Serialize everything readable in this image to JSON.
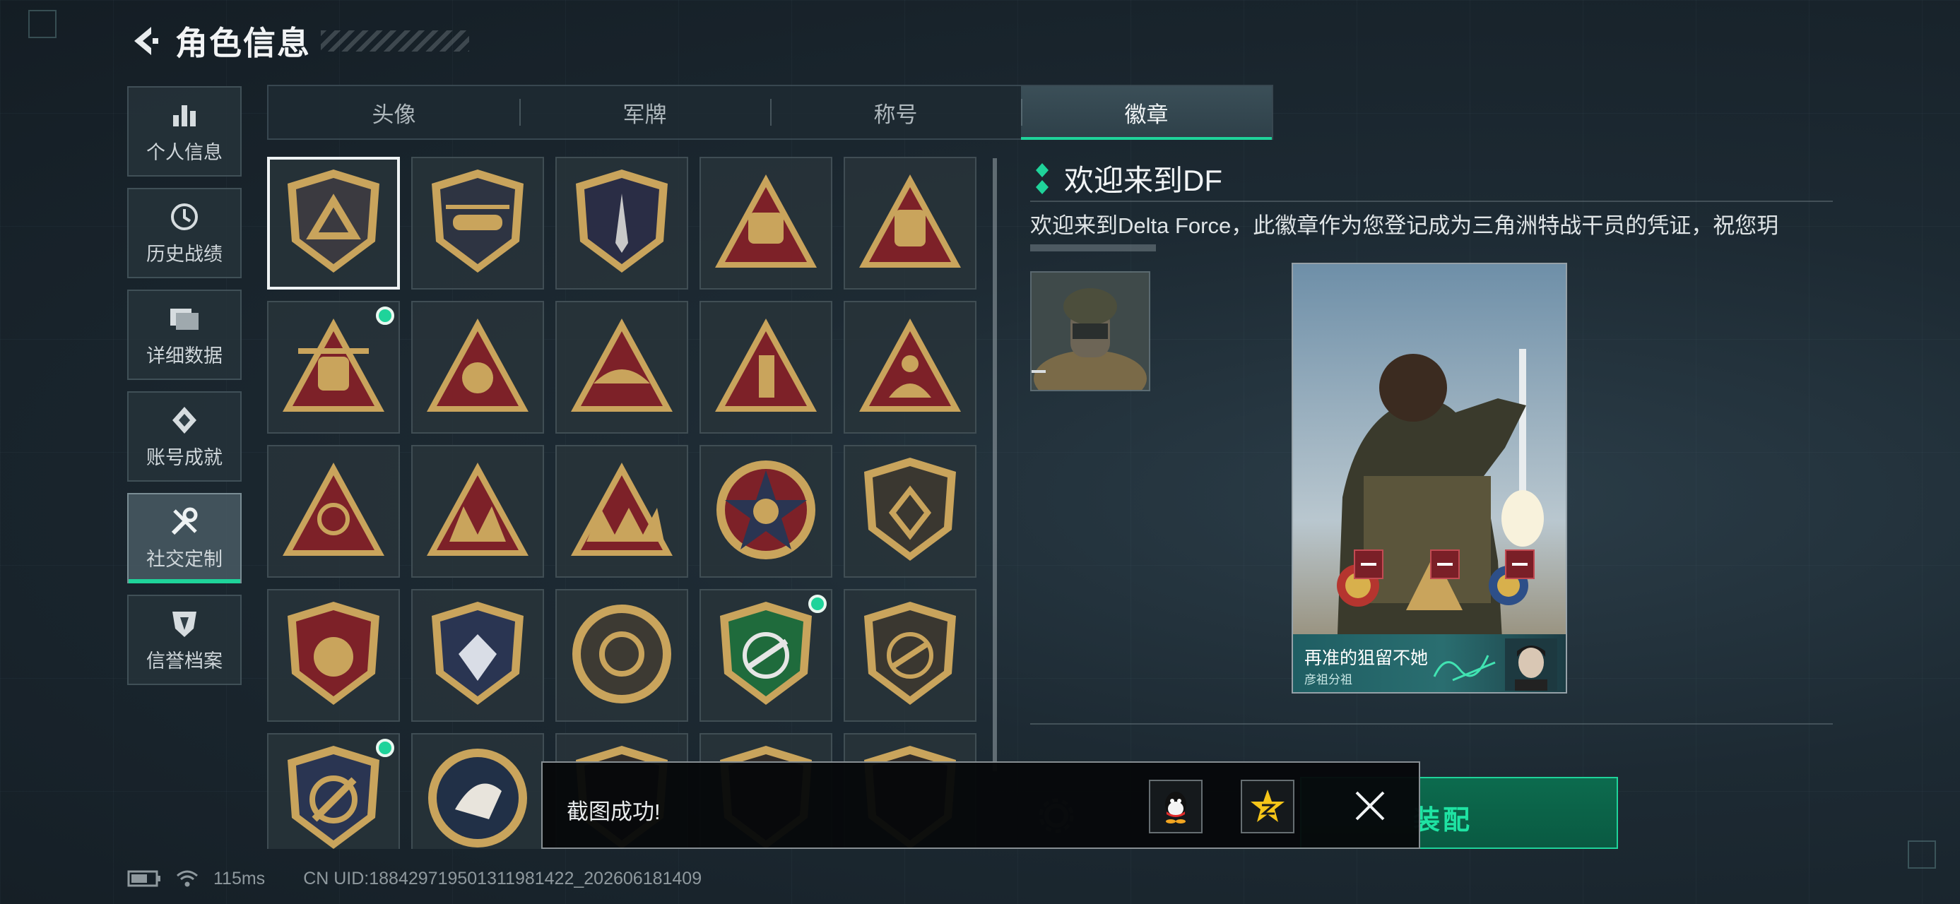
{
  "header": {
    "title": "角色信息"
  },
  "left_nav": [
    {
      "label": "个人信息",
      "icon": "bar-chart-icon"
    },
    {
      "label": "历史战绩",
      "icon": "history-clock-icon"
    },
    {
      "label": "详细数据",
      "icon": "folder-icon"
    },
    {
      "label": "账号成就",
      "icon": "achievement-icon"
    },
    {
      "label": "社交定制",
      "icon": "tools-icon",
      "active": true
    },
    {
      "label": "信誉档案",
      "icon": "shield-credit-icon"
    }
  ],
  "tabs": [
    {
      "label": "头像"
    },
    {
      "label": "军牌"
    },
    {
      "label": "称号"
    },
    {
      "label": "徽章",
      "active": true
    }
  ],
  "badges": {
    "rows": 5,
    "cols": 5,
    "selected_index": 0,
    "new_indicator_indices": [
      5,
      18,
      20
    ],
    "colors": {
      "gold": "#c9a45c",
      "maroon": "#7d2128",
      "navy": "#2a3552",
      "green": "#1f6b3c",
      "new_dot": "#1fd39a"
    }
  },
  "detail": {
    "title": "欢迎来到DF",
    "description": "欢迎来到Delta Force，此徽章作为您登记成为三角洲特战干员的凭证，祝您玥",
    "card": {
      "caption_main": "再准的狙留不她",
      "caption_sub": "彦祖分祖"
    },
    "equip_label": "装配"
  },
  "toast": {
    "message": "截图成功!",
    "share_buttons": [
      "qq-icon",
      "qzone-star-icon"
    ],
    "close_icon": "close-x-icon"
  },
  "status_bar": {
    "ping": "115ms",
    "uid": "CN UID:18842971950131198142​2_202606181409"
  },
  "accent_color": "#1fd39a"
}
